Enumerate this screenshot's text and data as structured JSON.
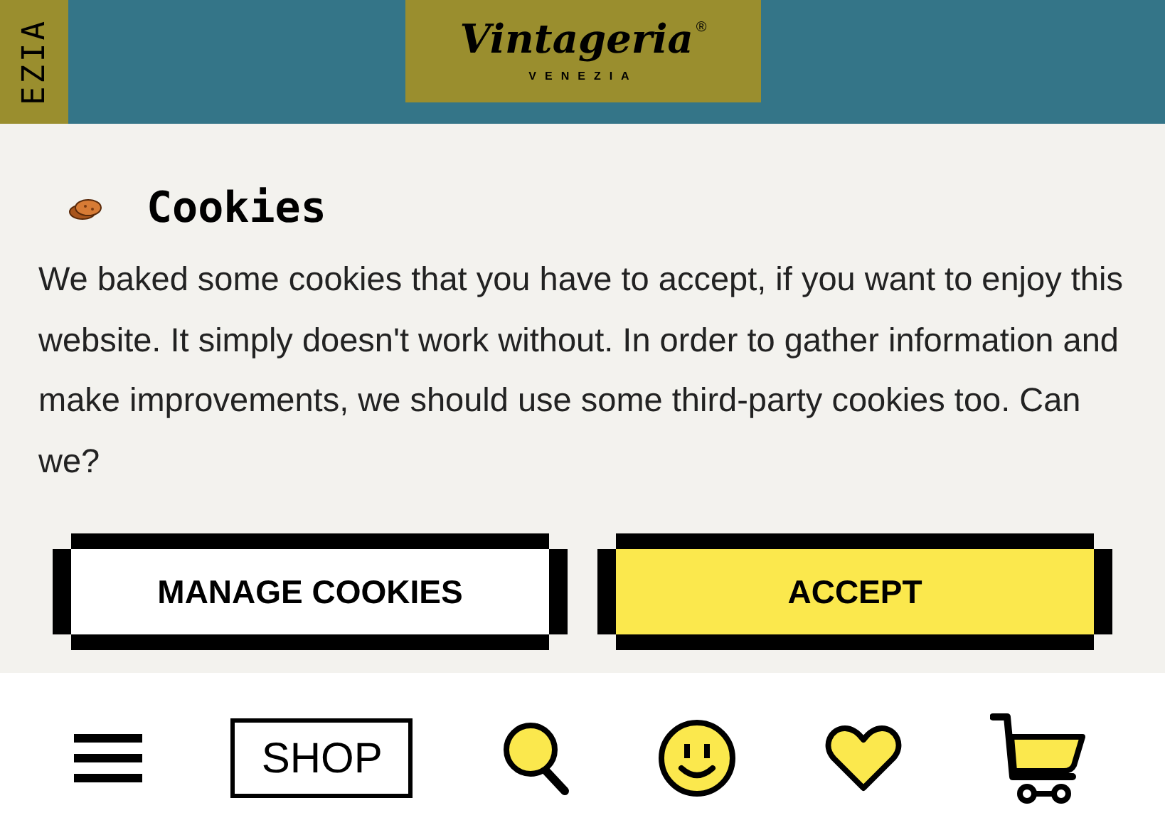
{
  "header": {
    "side_label": "EZIA",
    "logo": {
      "name": "Vintageria",
      "mark": "®",
      "subtitle": "VENEZIA"
    }
  },
  "cookie_banner": {
    "title": "Cookies",
    "text": "We baked some cookies that you have to accept, if you want to enjoy this website. It simply doesn't work without. In order to gather information and make improvements, we should use some third-party cookies too. Can we?",
    "buttons": [
      {
        "label": "MANAGE COOKIES",
        "kind": "secondary"
      },
      {
        "label": "ACCEPT",
        "kind": "primary"
      }
    ]
  },
  "bottom_nav": {
    "shop_label": "SHOP"
  }
}
